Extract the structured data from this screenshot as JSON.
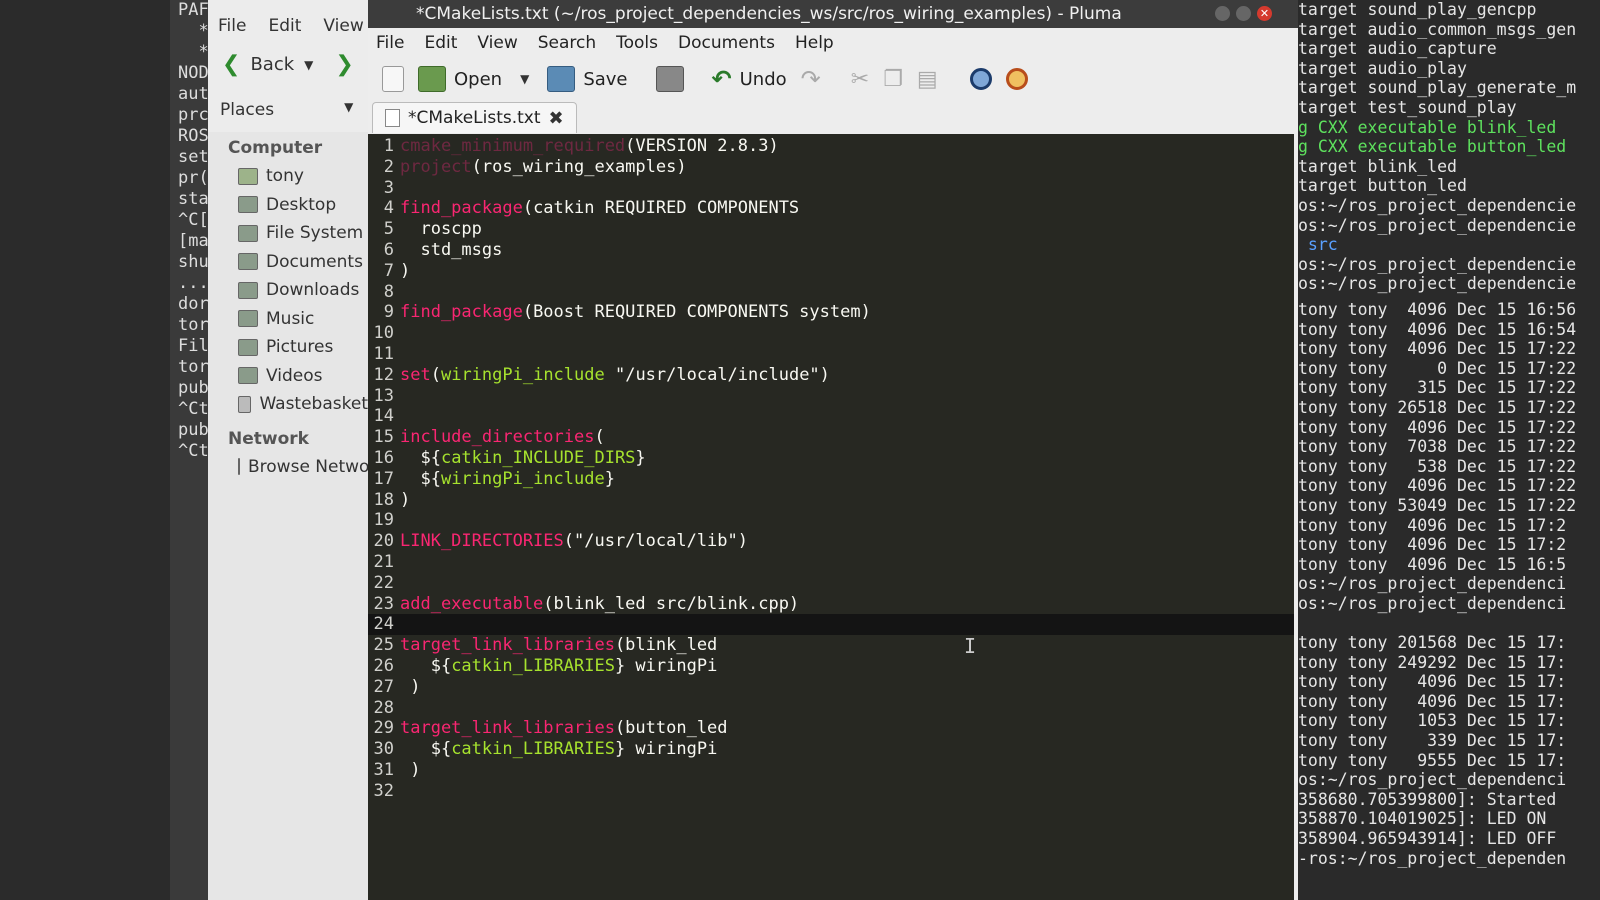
{
  "bg_terminal": {
    "lines": [
      "PAF",
      "  *",
      "  *",
      "",
      "NOD",
      "",
      "aut",
      "prc",
      "ROS",
      "",
      "set",
      "pr(",
      "sta",
      "^C[",
      "[ma",
      "shu",
      "...",
      "dor",
      "tor",
      "",
      "",
      "File",
      "tor",
      "pub",
      "^Ct",
      "pub",
      "^Ct"
    ]
  },
  "file_manager": {
    "menu": [
      "File",
      "Edit",
      "View"
    ],
    "back_label": "Back",
    "places_label": "Places",
    "computer_header": "Computer",
    "computer_items": [
      "tony",
      "Desktop",
      "File System",
      "Documents",
      "Downloads",
      "Music",
      "Pictures",
      "Videos",
      "Wastebasket"
    ],
    "network_header": "Network",
    "network_items": [
      "Browse Network"
    ]
  },
  "editor": {
    "window_title": "*CMakeLists.txt (~/ros_project_dependencies_ws/src/ros_wiring_examples) - Pluma",
    "menu": [
      "File",
      "Edit",
      "View",
      "Search",
      "Tools",
      "Documents",
      "Help"
    ],
    "toolbar": {
      "open": "Open",
      "save": "Save",
      "undo": "Undo"
    },
    "tab_title": "*CMakeLists.txt",
    "current_line": 24,
    "lines": [
      {
        "n": "1",
        "tokens": [
          {
            "c": "fn-dim",
            "t": "cmake_minimum_required"
          },
          {
            "c": "tx",
            "t": "(VERSION 2.8.3)"
          }
        ]
      },
      {
        "n": "2",
        "tokens": [
          {
            "c": "fn-dim",
            "t": "project"
          },
          {
            "c": "tx",
            "t": "(ros_wiring_examples)"
          }
        ]
      },
      {
        "n": "3",
        "tokens": []
      },
      {
        "n": "4",
        "tokens": [
          {
            "c": "fn",
            "t": "find_package"
          },
          {
            "c": "tx",
            "t": "(catkin REQUIRED COMPONENTS"
          }
        ]
      },
      {
        "n": "5",
        "tokens": [
          {
            "c": "tx",
            "t": "  roscpp"
          }
        ]
      },
      {
        "n": "6",
        "tokens": [
          {
            "c": "tx",
            "t": "  std_msgs"
          }
        ]
      },
      {
        "n": "7",
        "tokens": [
          {
            "c": "tx",
            "t": ")"
          }
        ]
      },
      {
        "n": "8",
        "tokens": []
      },
      {
        "n": "9",
        "tokens": [
          {
            "c": "fn",
            "t": "find_package"
          },
          {
            "c": "tx",
            "t": "(Boost REQUIRED COMPONENTS system)"
          }
        ]
      },
      {
        "n": "10",
        "tokens": []
      },
      {
        "n": "11",
        "tokens": []
      },
      {
        "n": "12",
        "tokens": [
          {
            "c": "fn",
            "t": "set"
          },
          {
            "c": "tx",
            "t": "("
          },
          {
            "c": "var",
            "t": "wiringPi_include"
          },
          {
            "c": "tx",
            "t": " \"/usr/local/include\")"
          }
        ]
      },
      {
        "n": "13",
        "tokens": []
      },
      {
        "n": "14",
        "tokens": []
      },
      {
        "n": "15",
        "tokens": [
          {
            "c": "fn",
            "t": "include_directories"
          },
          {
            "c": "tx",
            "t": "("
          }
        ]
      },
      {
        "n": "16",
        "tokens": [
          {
            "c": "tx",
            "t": "  ${"
          },
          {
            "c": "var",
            "t": "catkin_INCLUDE_DIRS"
          },
          {
            "c": "tx",
            "t": "}"
          }
        ]
      },
      {
        "n": "17",
        "tokens": [
          {
            "c": "tx",
            "t": "  ${"
          },
          {
            "c": "var",
            "t": "wiringPi_include"
          },
          {
            "c": "tx",
            "t": "}"
          }
        ]
      },
      {
        "n": "18",
        "tokens": [
          {
            "c": "tx",
            "t": ")"
          }
        ]
      },
      {
        "n": "19",
        "tokens": []
      },
      {
        "n": "20",
        "tokens": [
          {
            "c": "fn",
            "t": "LINK_DIRECTORIES"
          },
          {
            "c": "tx",
            "t": "(\"/usr/local/lib\")"
          }
        ]
      },
      {
        "n": "21",
        "tokens": []
      },
      {
        "n": "22",
        "tokens": []
      },
      {
        "n": "23",
        "tokens": [
          {
            "c": "fn",
            "t": "add_executable"
          },
          {
            "c": "tx",
            "t": "(blink_led src/blink.cpp)"
          }
        ]
      },
      {
        "n": "24",
        "tokens": []
      },
      {
        "n": "25",
        "tokens": [
          {
            "c": "fn",
            "t": "target_link_libraries"
          },
          {
            "c": "tx",
            "t": "(blink_led"
          }
        ]
      },
      {
        "n": "26",
        "tokens": [
          {
            "c": "tx",
            "t": "   ${"
          },
          {
            "c": "var",
            "t": "catkin_LIBRARIES"
          },
          {
            "c": "tx",
            "t": "} wiringPi"
          }
        ]
      },
      {
        "n": "27",
        "tokens": [
          {
            "c": "tx",
            "t": " )"
          }
        ]
      },
      {
        "n": "28",
        "tokens": []
      },
      {
        "n": "29",
        "tokens": [
          {
            "c": "fn",
            "t": "target_link_libraries"
          },
          {
            "c": "tx",
            "t": "(button_led"
          }
        ]
      },
      {
        "n": "30",
        "tokens": [
          {
            "c": "tx",
            "t": "   ${"
          },
          {
            "c": "var",
            "t": "catkin_LIBRARIES"
          },
          {
            "c": "tx",
            "t": "} wiringPi"
          }
        ]
      },
      {
        "n": "31",
        "tokens": [
          {
            "c": "tx",
            "t": " )"
          }
        ]
      },
      {
        "n": "32",
        "tokens": []
      }
    ]
  },
  "right_terminal": {
    "top_lines": [
      {
        "t": "target sound_play_gencpp",
        "c": ""
      },
      {
        "t": "target audio_common_msgs_gen",
        "c": ""
      },
      {
        "t": "target audio_capture",
        "c": ""
      },
      {
        "t": "target audio_play",
        "c": ""
      },
      {
        "t": "target sound_play_generate_m",
        "c": ""
      },
      {
        "t": "target test_sound_play",
        "c": ""
      },
      {
        "t": "g CXX executable blink_led",
        "c": "green"
      },
      {
        "t": "g CXX executable button_led",
        "c": "green"
      },
      {
        "t": "target blink_led",
        "c": ""
      },
      {
        "t": "target button_led",
        "c": ""
      },
      {
        "t": "os:~/ros_project_dependencie",
        "c": ""
      },
      {
        "t": "os:~/ros_project_dependencie",
        "c": ""
      },
      {
        "t": " src",
        "c": "blue"
      },
      {
        "t": "os:~/ros_project_dependencie",
        "c": ""
      },
      {
        "t": "os:~/ros_project_dependencie",
        "c": ""
      }
    ],
    "bottom_lines": [
      "tony tony  4096 Dec 15 16:56",
      "tony tony  4096 Dec 15 16:54",
      "tony tony  4096 Dec 15 17:22",
      "tony tony     0 Dec 15 17:22",
      "tony tony   315 Dec 15 17:22",
      "tony tony 26518 Dec 15 17:22",
      "tony tony  4096 Dec 15 17:22",
      "tony tony  7038 Dec 15 17:22",
      "tony tony   538 Dec 15 17:22",
      "tony tony  4096 Dec 15 17:22",
      "tony tony 53049 Dec 15 17:22",
      "tony tony  4096 Dec 15 17:2",
      "tony tony  4096 Dec 15 17:2",
      "tony tony  4096 Dec 15 16:5",
      "os:~/ros_project_dependenci",
      "os:~/ros_project_dependenci",
      "",
      "tony tony 201568 Dec 15 17:",
      "tony tony 249292 Dec 15 17:",
      "tony tony   4096 Dec 15 17:",
      "tony tony   4096 Dec 15 17:",
      "tony tony   1053 Dec 15 17:",
      "tony tony    339 Dec 15 17:",
      "tony tony   9555 Dec 15 17:",
      "os:~/ros_project_dependenci",
      "358680.705399800]: Started",
      "358870.104019025]: LED ON",
      "358904.965943914]: LED OFF",
      "-ros:~/ros_project_dependen"
    ]
  }
}
